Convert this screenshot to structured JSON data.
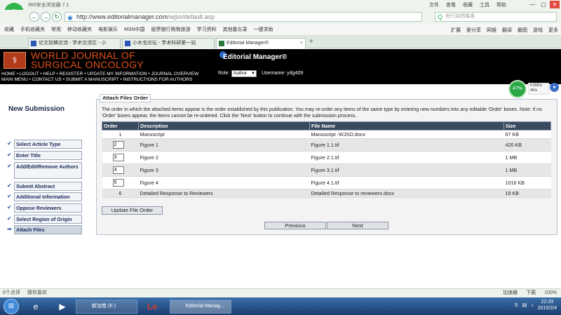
{
  "browser": {
    "app_title": "360安全浏览器 7.1",
    "menus": [
      "文件",
      "查看",
      "收藏",
      "工具",
      "帮助"
    ],
    "url_host": "http://www.editorialmanager.com",
    "url_path": "/wjso/default.asp",
    "search_placeholder": "央行突然降准",
    "favorites": [
      "收藏",
      "手机收藏夹",
      "常用",
      "移动收藏夹",
      "电影娱乐",
      "MSN中国",
      "股票银行购物旅游",
      "学习资料",
      "其他备忘录",
      "一键求助"
    ],
    "fav_right": [
      "扩展",
      "爱分享",
      "网银",
      "翻译",
      "截图",
      "游戏",
      "更多"
    ],
    "tabs": [
      {
        "label": "论文投稿交流 - 学术交流区 - 小"
      },
      {
        "label": "小木虫论坛 - 学术科研第一站"
      },
      {
        "label": "Editorial Manager®"
      }
    ]
  },
  "site": {
    "journal_title_1": "WORLD JOURNAL OF",
    "journal_title_2": "SURGICAL ONCOLOGY",
    "em_logo": "Editorial Manager®",
    "nav_row1": "HOME • LOGOUT • HELP • REGISTER • UPDATE MY INFORMATION • JOURNAL OVERVIEW",
    "nav_row2": "MAIN MENU • CONTACT US • SUBMIT A MANUSCRIPT • INSTRUCTIONS FOR AUTHORS",
    "role_label": "Role:",
    "role_value": "Author",
    "username": "Username: ydg409"
  },
  "speed_widget": {
    "percent": "47%",
    "up": "0.05K/s",
    "down": "0K/s"
  },
  "page": {
    "title": "New Submission",
    "sidebar": [
      "Select Article Type",
      "Enter Title",
      "Add/Edit/Remove Authors",
      "Submit Abstract",
      "Additional Information",
      "Oppose Reviewers",
      "Select Region of Origin",
      "Attach Files"
    ],
    "panel_legend": "Attach Files Order",
    "instructions": "The order in which the attached items appear is the order established by this publication. You may re-order any items of the same type by entering new numbers into any editable 'Order' boxes. Note: if no 'Order' boxes appear, the Items cannot be re-ordered. Click the 'Next' button to continue with the submission process.",
    "columns": [
      "Order",
      "Description",
      "File Name",
      "Size"
    ],
    "rows": [
      {
        "order": "1",
        "description": "Manuscript",
        "file": "Manuscript -WJSO.docx",
        "size": "67 KB"
      },
      {
        "order": "2",
        "description": "Figure 1",
        "file": "Figure 1.1.tif",
        "size": "420 KB"
      },
      {
        "order": "3",
        "description": "Figure 2",
        "file": "Figure 2.1.tif",
        "size": "1 MB"
      },
      {
        "order": "4",
        "description": "Figure 3",
        "file": "Figure 3.1.tif",
        "size": "1 MB"
      },
      {
        "order": "5",
        "description": "Figure 4",
        "file": "Figure 4.1.tif",
        "size": "1016 KB"
      },
      {
        "order": "6",
        "description": "Detailed Response to Reviewers",
        "file": "Detailed Response to reviewers.docx",
        "size": "19 KB"
      }
    ],
    "update_button": "Update File Order",
    "previous_button": "Previous",
    "next_button": "Next"
  },
  "statusbar": {
    "left1": "0个点评",
    "left2": "猜你喜欢",
    "right": [
      "加速器",
      "下载",
      "100%"
    ]
  },
  "taskbar": {
    "items": [
      "新加卷 (E:)",
      "Editorial Manag..."
    ],
    "time": "22:33",
    "date": "2015/2/4"
  }
}
